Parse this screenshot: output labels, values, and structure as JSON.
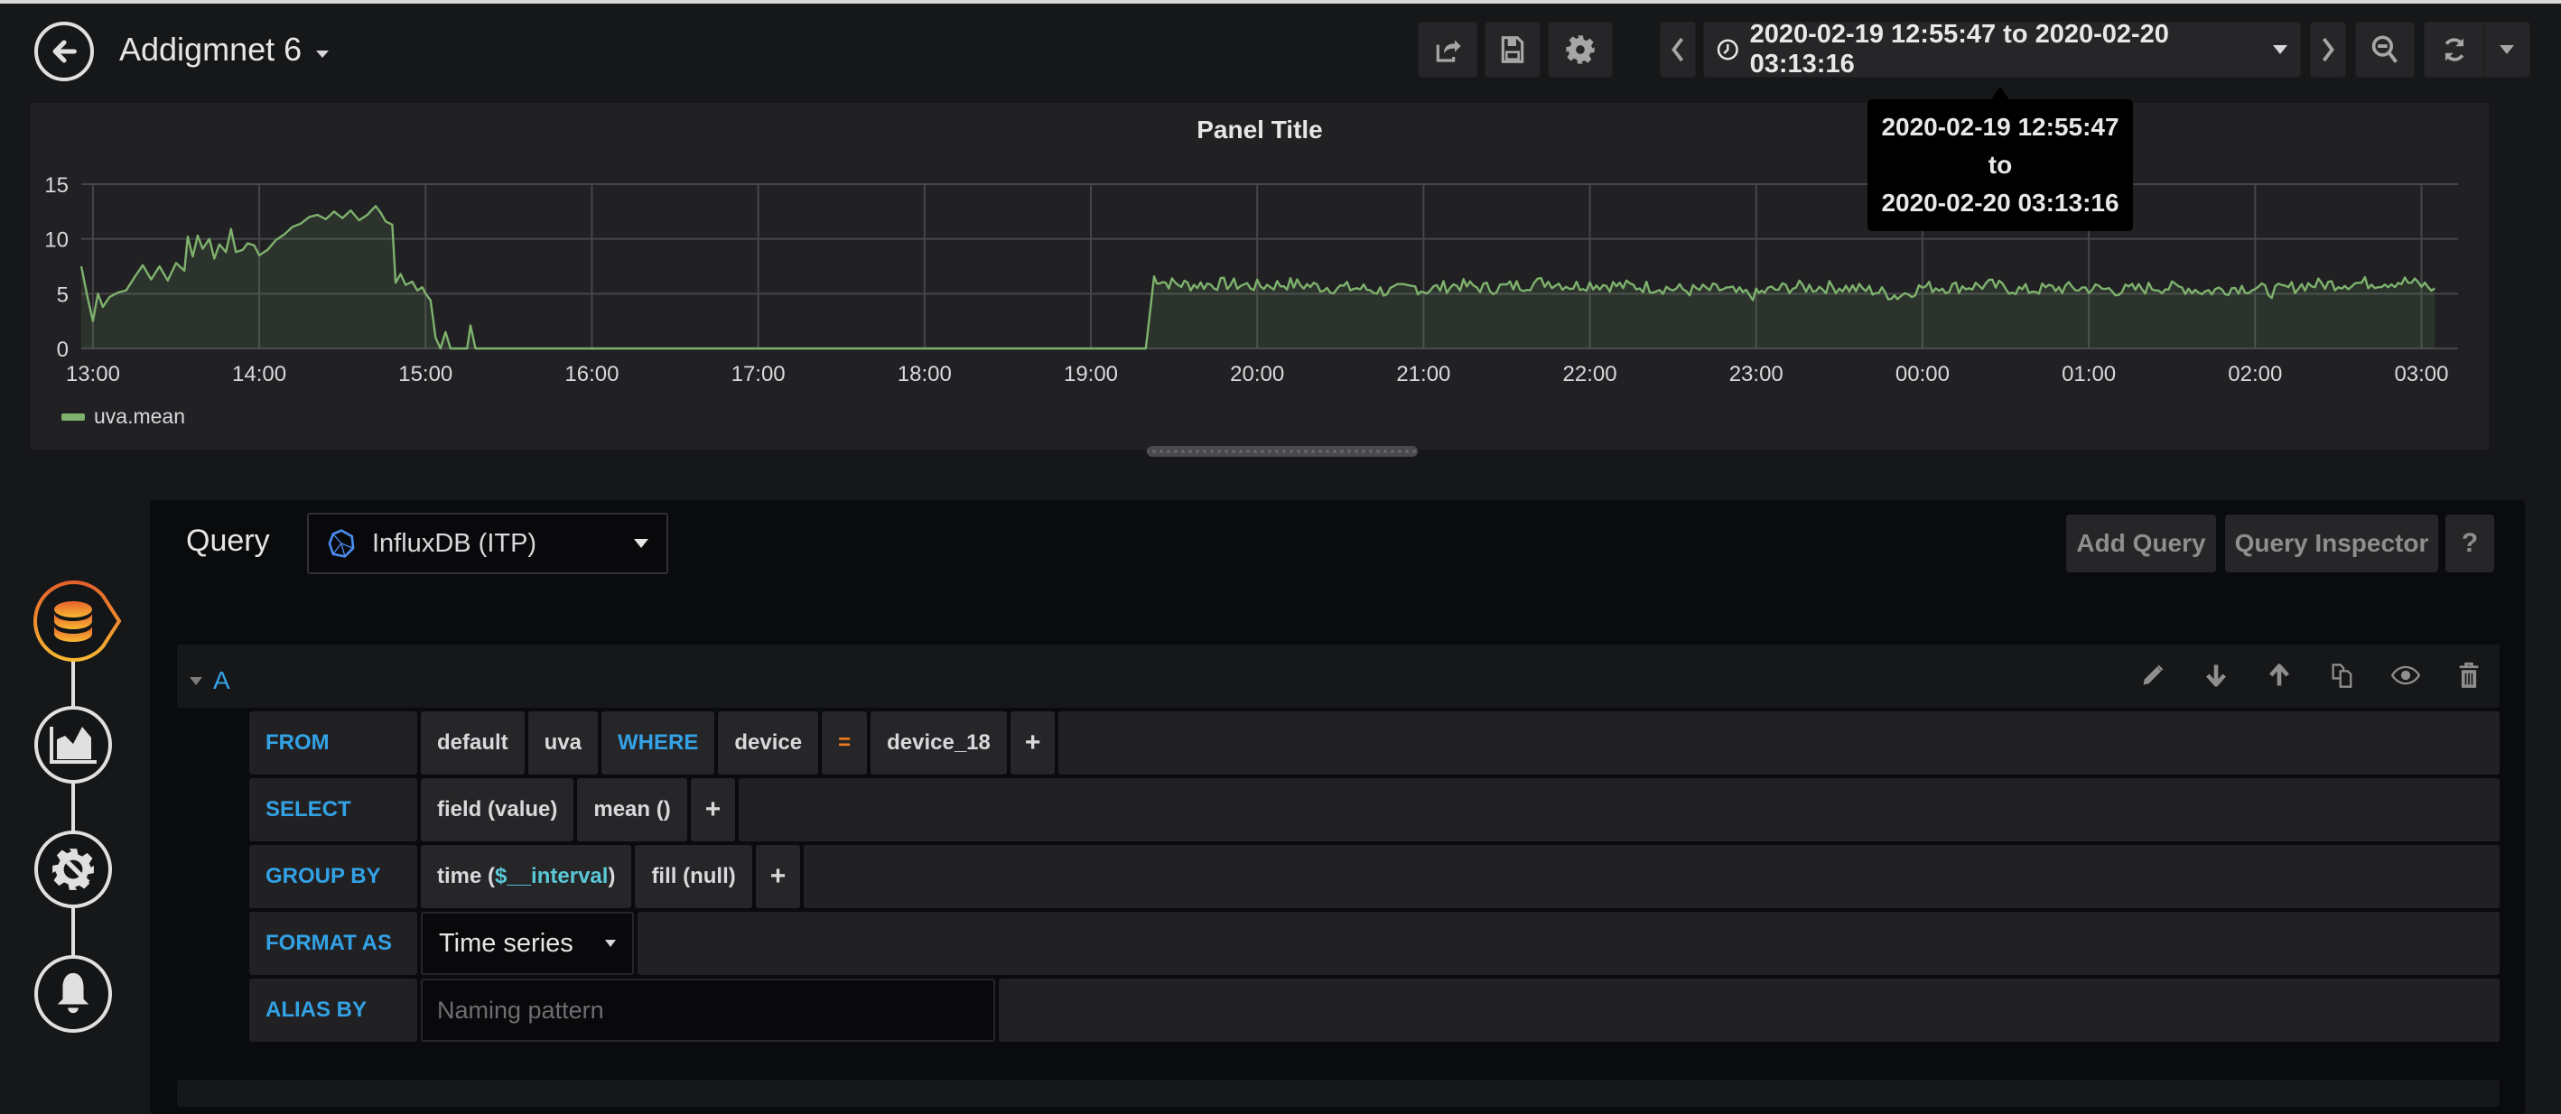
{
  "header": {
    "title": "Addigmnet 6",
    "time_range": "2020-02-19 12:55:47 to 2020-02-20 03:13:16",
    "icons": [
      "back-arrow-icon",
      "share-icon",
      "save-icon",
      "gear-icon",
      "chevron-left-icon",
      "clock-icon",
      "chevron-right-icon",
      "zoom-out-icon",
      "refresh-icon",
      "caret-down-icon"
    ]
  },
  "tooltip": {
    "from": "2020-02-19 12:55:47",
    "sep": "to",
    "to": "2020-02-20 03:13:16"
  },
  "panel": {
    "title": "Panel Title",
    "legend": "uva.mean"
  },
  "colors": {
    "series": "#7eb26d",
    "accent_blue": "#33a2e5",
    "operator_orange": "#eb7b18",
    "active_nav_gradient": [
      "#e5622b",
      "#f7b733"
    ]
  },
  "chart_data": {
    "type": "area",
    "title": "Panel Title",
    "xlabel": "",
    "ylabel": "",
    "x_ticks": [
      "13:00",
      "14:00",
      "15:00",
      "16:00",
      "17:00",
      "18:00",
      "19:00",
      "20:00",
      "21:00",
      "22:00",
      "23:00",
      "00:00",
      "01:00",
      "02:00",
      "03:00"
    ],
    "y_ticks": [
      0,
      5,
      10,
      15
    ],
    "ylim": [
      0,
      15
    ],
    "xlim_hours": [
      12.93,
      27.22
    ],
    "grid": true,
    "legend": "bottom-left",
    "series": [
      {
        "name": "uva.mean",
        "points_hours": [
          [
            12.93,
            7.5
          ],
          [
            12.97,
            4.5
          ],
          [
            13.0,
            2.5
          ],
          [
            13.03,
            5.0
          ],
          [
            13.06,
            3.8
          ],
          [
            13.1,
            4.7
          ],
          [
            13.15,
            5.1
          ],
          [
            13.2,
            5.3
          ],
          [
            13.25,
            6.5
          ],
          [
            13.3,
            7.6
          ],
          [
            13.35,
            6.3
          ],
          [
            13.4,
            7.5
          ],
          [
            13.45,
            6.2
          ],
          [
            13.5,
            7.8
          ],
          [
            13.55,
            7.1
          ],
          [
            13.57,
            10.2
          ],
          [
            13.6,
            8.4
          ],
          [
            13.63,
            10.3
          ],
          [
            13.66,
            9.1
          ],
          [
            13.7,
            10.0
          ],
          [
            13.73,
            8.2
          ],
          [
            13.76,
            9.5
          ],
          [
            13.8,
            8.8
          ],
          [
            13.83,
            10.9
          ],
          [
            13.86,
            8.8
          ],
          [
            13.9,
            9.0
          ],
          [
            13.93,
            9.6
          ],
          [
            13.97,
            9.4
          ],
          [
            14.0,
            8.5
          ],
          [
            14.05,
            9.0
          ],
          [
            14.1,
            9.9
          ],
          [
            14.15,
            10.4
          ],
          [
            14.2,
            11.1
          ],
          [
            14.25,
            11.4
          ],
          [
            14.3,
            12.0
          ],
          [
            14.35,
            12.2
          ],
          [
            14.4,
            11.8
          ],
          [
            14.45,
            12.5
          ],
          [
            14.5,
            11.9
          ],
          [
            14.55,
            12.6
          ],
          [
            14.6,
            11.7
          ],
          [
            14.65,
            12.2
          ],
          [
            14.7,
            13.0
          ],
          [
            14.73,
            12.4
          ],
          [
            14.76,
            11.6
          ],
          [
            14.8,
            11.3
          ],
          [
            14.82,
            6.0
          ],
          [
            14.85,
            6.8
          ],
          [
            14.88,
            5.8
          ],
          [
            14.92,
            6.1
          ],
          [
            14.95,
            5.3
          ],
          [
            14.98,
            5.6
          ],
          [
            15.0,
            5.0
          ],
          [
            15.03,
            4.4
          ],
          [
            15.06,
            1.0
          ],
          [
            15.09,
            0.0
          ],
          [
            15.12,
            1.5
          ],
          [
            15.15,
            0.0
          ],
          [
            15.25,
            0.0
          ],
          [
            15.27,
            2.1
          ],
          [
            15.3,
            0.0
          ],
          [
            19.33,
            0.0
          ],
          [
            19.38,
            6.5
          ],
          [
            19.45,
            6.0
          ],
          [
            19.6,
            5.8
          ],
          [
            19.8,
            5.9
          ],
          [
            20.0,
            5.7
          ],
          [
            20.2,
            5.9
          ],
          [
            20.4,
            5.6
          ],
          [
            20.6,
            5.5
          ],
          [
            20.8,
            5.2
          ],
          [
            20.95,
            5.6
          ],
          [
            21.0,
            5.3
          ],
          [
            21.2,
            5.8
          ],
          [
            21.4,
            5.5
          ],
          [
            21.6,
            5.8
          ],
          [
            21.75,
            6.1
          ],
          [
            21.9,
            5.7
          ],
          [
            22.0,
            5.9
          ],
          [
            22.2,
            5.7
          ],
          [
            22.4,
            5.6
          ],
          [
            22.6,
            5.3
          ],
          [
            22.8,
            5.4
          ],
          [
            22.9,
            5.0
          ],
          [
            23.0,
            4.9
          ],
          [
            23.05,
            5.2
          ],
          [
            23.2,
            5.6
          ],
          [
            23.5,
            5.6
          ],
          [
            23.7,
            5.3
          ],
          [
            23.85,
            4.8
          ],
          [
            24.0,
            5.6
          ],
          [
            24.2,
            5.6
          ],
          [
            24.4,
            5.8
          ],
          [
            24.6,
            5.3
          ],
          [
            24.8,
            5.5
          ],
          [
            25.0,
            5.5
          ],
          [
            25.2,
            5.3
          ],
          [
            25.4,
            5.6
          ],
          [
            25.6,
            5.5
          ],
          [
            25.7,
            5.2
          ],
          [
            25.9,
            5.6
          ],
          [
            26.0,
            5.5
          ],
          [
            26.1,
            5.2
          ],
          [
            26.3,
            5.8
          ],
          [
            26.5,
            5.9
          ],
          [
            26.7,
            6.0
          ],
          [
            26.9,
            6.1
          ],
          [
            27.0,
            5.8
          ],
          [
            27.08,
            5.5
          ]
        ]
      }
    ]
  },
  "nav": {
    "items": [
      {
        "name": "queries",
        "icon": "database-icon",
        "active": true
      },
      {
        "name": "visualization",
        "icon": "area-chart-icon",
        "active": false
      },
      {
        "name": "general",
        "icon": "gear-wrench-icon",
        "active": false
      },
      {
        "name": "alert",
        "icon": "bell-icon",
        "active": false
      }
    ]
  },
  "query": {
    "label": "Query",
    "datasource": "InfluxDB (ITP)",
    "add_query": "Add Query",
    "query_inspector": "Query Inspector",
    "help": "?",
    "row_letter": "A",
    "from": {
      "keyword": "FROM",
      "policy": "default",
      "measurement": "uva",
      "where_keyword": "WHERE",
      "tag_key": "device",
      "operator": "=",
      "tag_value": "device_18",
      "add": "+"
    },
    "select": {
      "keyword": "SELECT",
      "field": "field (value)",
      "agg": "mean ()",
      "add": "+"
    },
    "group_by": {
      "keyword": "GROUP BY",
      "time_prefix": "time (",
      "time_var": "$__interval",
      "time_suffix": ")",
      "fill": "fill (null)",
      "add": "+"
    },
    "format_as": {
      "keyword": "FORMAT AS",
      "value": "Time series"
    },
    "alias_by": {
      "keyword": "ALIAS BY",
      "value": "",
      "placeholder": "Naming pattern"
    }
  }
}
